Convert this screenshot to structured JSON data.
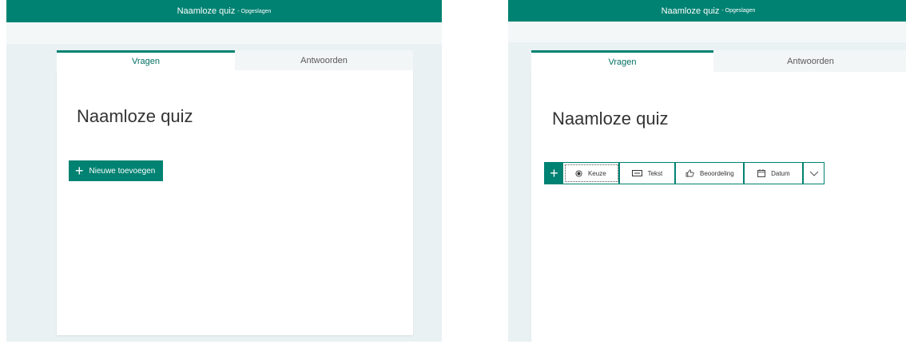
{
  "app": {
    "title": "Naamloze quiz",
    "status": "- Opgeslagen"
  },
  "tabs": [
    {
      "label": "Vragen",
      "active": true
    },
    {
      "label": "Antwoorden",
      "active": false
    }
  ],
  "quiz": {
    "title": "Naamloze quiz"
  },
  "add_button": {
    "label": "Nieuwe toevoegen",
    "icon": "plus-icon"
  },
  "question_types": [
    {
      "label": "Keuze",
      "icon": "radio-icon"
    },
    {
      "label": "Tekst",
      "icon": "text-icon"
    },
    {
      "label": "Beoordeling",
      "icon": "thumbs-up-icon"
    },
    {
      "label": "Datum",
      "icon": "calendar-icon"
    }
  ],
  "colors": {
    "brand": "#008272",
    "background": "#e9f1f3"
  }
}
